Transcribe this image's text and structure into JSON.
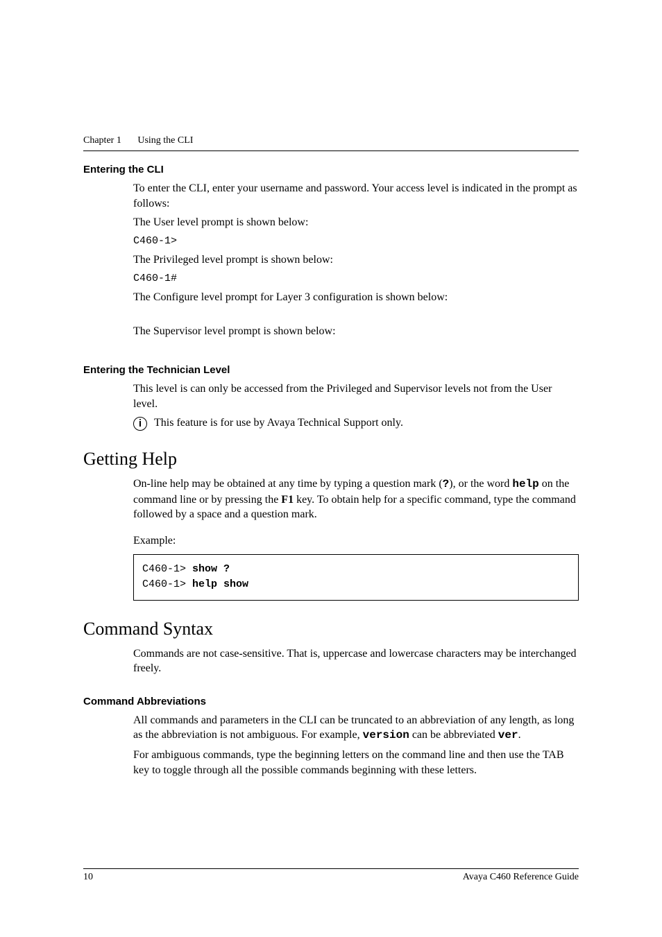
{
  "running_head": {
    "chapter": "Chapter 1",
    "title": "Using the CLI"
  },
  "sections": {
    "entering_cli": {
      "heading": "Entering the CLI",
      "p1": "To enter the CLI, enter your username and password. Your access level is indicated in the prompt as follows:",
      "p2": "The User level prompt is shown below:",
      "code1": "C460-1>",
      "p3": "The Privileged level prompt is shown below:",
      "code2": "C460-1#",
      "p4": "The Configure level prompt for Layer 3 configuration is shown below:",
      "p5": "The Supervisor level prompt is shown below:"
    },
    "tech_level": {
      "heading": "Entering the Technician Level",
      "p1": "This level is can only be accessed from the Privileged and Supervisor levels not from the User level.",
      "info": "This feature is for use by Avaya Technical Support only.",
      "info_symbol": "i"
    },
    "getting_help": {
      "heading": "Getting Help",
      "p1a": "On-line help may be obtained at any time by typing a question mark (",
      "qmark": "?",
      "p1b": "), or the word ",
      "help_cmd": "help",
      "p1c": " on the command line or by pressing the ",
      "f1": "F1",
      "p1d": " key. To obtain help for a specific command, type the command followed by a space and a question mark.",
      "example_label": "Example:",
      "ex_prompt1": "C460-1> ",
      "ex_cmd1": "show ?",
      "ex_prompt2": "C460-1> ",
      "ex_cmd2": "help show"
    },
    "command_syntax": {
      "heading": "Command Syntax",
      "p1": "Commands are not case-sensitive. That is, uppercase and lowercase characters may be interchanged freely."
    },
    "command_abbrev": {
      "heading": "Command Abbreviations",
      "p1a": "All commands and parameters in the CLI can be truncated to an abbreviation of any length, as long as the abbreviation is not ambiguous. For example, ",
      "version_cmd": "version",
      "p1b": " can be abbreviated ",
      "ver_cmd": "ver",
      "p1c": ".",
      "p2": "For ambiguous commands, type the beginning letters on the command line and then use the TAB key to toggle through all the possible commands beginning with these letters."
    }
  },
  "footer": {
    "page_no": "10",
    "doc_title": "Avaya C460 Reference Guide"
  }
}
